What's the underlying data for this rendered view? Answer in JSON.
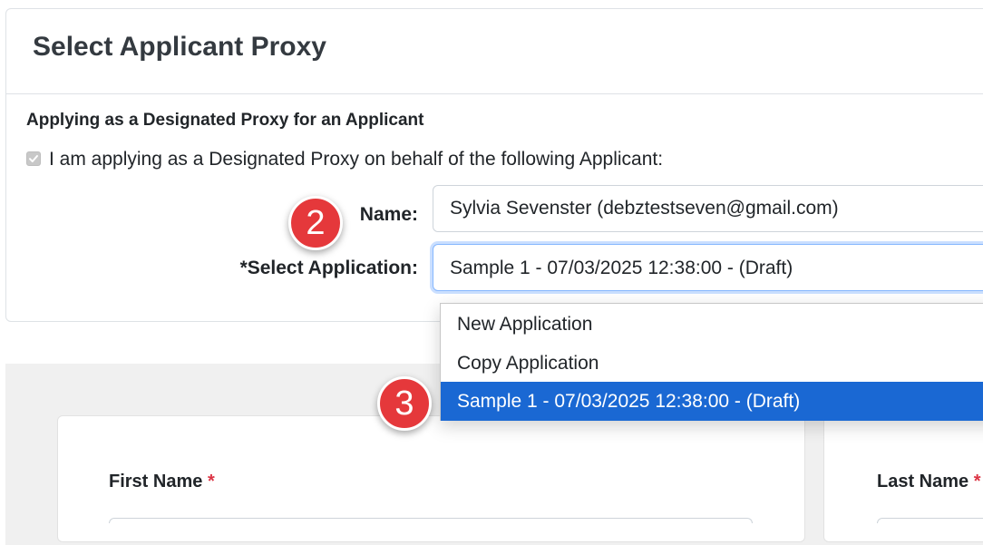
{
  "card": {
    "title": "Select Applicant Proxy",
    "section_heading": "Applying as a Designated Proxy for an Applicant",
    "proxy_checkbox_label": "I am applying as a Designated Proxy on behalf of the following Applicant:",
    "proxy_checkbox_checked": true
  },
  "form": {
    "name_label": "Name:",
    "name_value": "Sylvia Sevenster (debztestseven@gmail.com)",
    "application_label": "*Select Application:",
    "application_selected": "Sample 1 - 07/03/2025 12:38:00 - (Draft)"
  },
  "dropdown": {
    "options": [
      {
        "label": "New Application",
        "selected": false
      },
      {
        "label": "Copy Application",
        "selected": false
      },
      {
        "label": "Sample 1 - 07/03/2025 12:38:00 - (Draft)",
        "selected": true
      }
    ],
    "highlight_color": "#1a68d3"
  },
  "applicant_form": {
    "first_name_label": "First Name",
    "last_name_label": "Last Name",
    "required_marker": "*",
    "required_color": "#dc3545"
  },
  "markers": {
    "step_name": "2",
    "step_option": "3",
    "marker_color": "#e5383b"
  }
}
